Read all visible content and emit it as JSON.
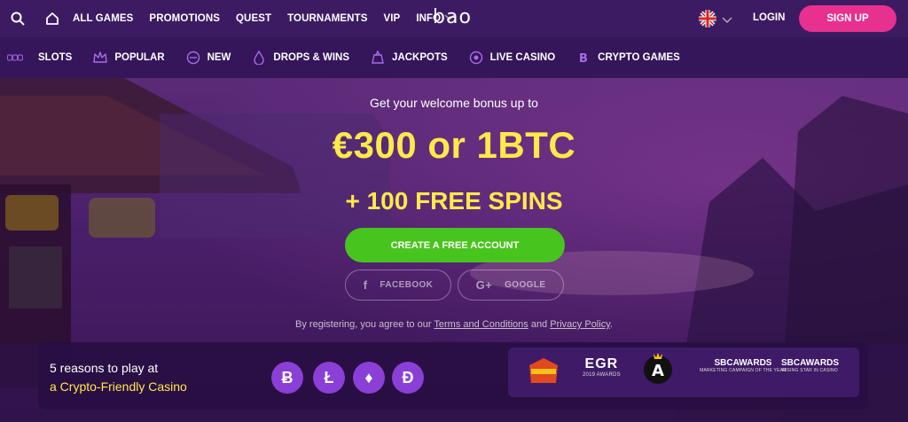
{
  "header": {
    "nav": [
      "ALL GAMES",
      "PROMOTIONS",
      "QUEST",
      "TOURNAMENTS",
      "VIP",
      "INFO"
    ],
    "logo": "bao",
    "login": "LOGIN",
    "signup": "SIGN UP"
  },
  "categories": [
    {
      "label": "SLOTS",
      "icon": "slots-icon"
    },
    {
      "label": "POPULAR",
      "icon": "crown-icon"
    },
    {
      "label": "NEW",
      "icon": "new-icon"
    },
    {
      "label": "DROPS & WINS",
      "icon": "drops-icon"
    },
    {
      "label": "JACKPOTS",
      "icon": "jackpot-icon"
    },
    {
      "label": "LIVE CASINO",
      "icon": "live-casino-icon"
    },
    {
      "label": "CRYPTO GAMES",
      "icon": "crypto-icon"
    }
  ],
  "hero": {
    "welcome": "Get your welcome bonus up to",
    "amount": "€300 or 1BTC",
    "spins": "+ 100 FREE SPINS",
    "cta": "CREATE A FREE ACCOUNT",
    "facebook": "FACEBOOK",
    "google": "GOOGLE",
    "terms_prefix": "By registering, you agree to our ",
    "terms_link": "Terms and Conditions",
    "terms_and": " and ",
    "privacy_link": "Privacy Policy",
    "terms_suffix": "."
  },
  "reasons": {
    "line1": "5 reasons to play at",
    "line2": "a Crypto-Friendly Casino",
    "coins": [
      "Ƀ",
      "Ł",
      "♦",
      "Đ"
    ]
  },
  "awards": {
    "egr": "EGR",
    "egr_sub": "2019 AWARDS",
    "sbc1": "SBCAWARDS",
    "sbc1_sub": "MARKETING CAMPAIGN OF THE YEAR",
    "sbc2": "SBCAWARDS",
    "sbc2_sub": "RISING STAR IN CASINO"
  },
  "colors": {
    "accent_pink": "#e8308f",
    "cta_green": "#48c41e",
    "highlight_yellow": "#ffe94a",
    "nav_bg": "#3d1b63"
  }
}
